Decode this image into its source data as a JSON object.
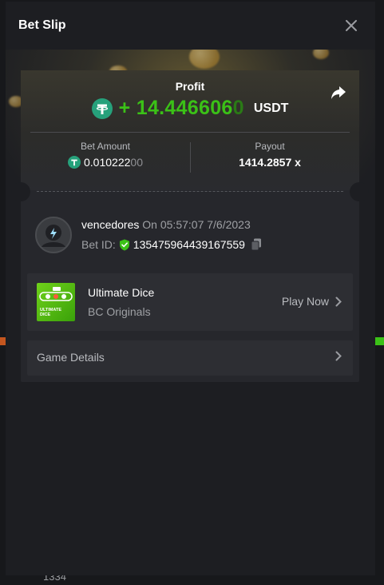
{
  "modal": {
    "title": "Bet Slip"
  },
  "profit": {
    "label": "Profit",
    "sign": "+",
    "value_main": "14.446606",
    "value_faded": "0",
    "currency": "USDT"
  },
  "bet_amount": {
    "label": "Bet Amount",
    "value_main": "0.010222",
    "value_faded": "00"
  },
  "payout": {
    "label": "Payout",
    "value": "1414.2857 x"
  },
  "bet": {
    "username": "vencedores",
    "on_label": "On",
    "time": "05:57:07 7/6/2023",
    "id_label": "Bet ID:",
    "id": "135475964439167559"
  },
  "game": {
    "name": "Ultimate Dice",
    "provider": "BC Originals",
    "play_label": "Play Now",
    "thumb_text": "ULTIMATE DICE"
  },
  "details": {
    "label": "Game Details"
  },
  "background": {
    "bottom_number": "1334"
  },
  "colors": {
    "profit_green": "#3bc117",
    "usdt_teal": "#26a17b",
    "shield_green": "#3bc117"
  },
  "icons": {
    "close": "close-icon",
    "share": "share-icon",
    "usdt": "usdt-icon",
    "verified": "shield-check-icon",
    "copy": "copy-icon",
    "chevron": "chevron-right-icon"
  }
}
